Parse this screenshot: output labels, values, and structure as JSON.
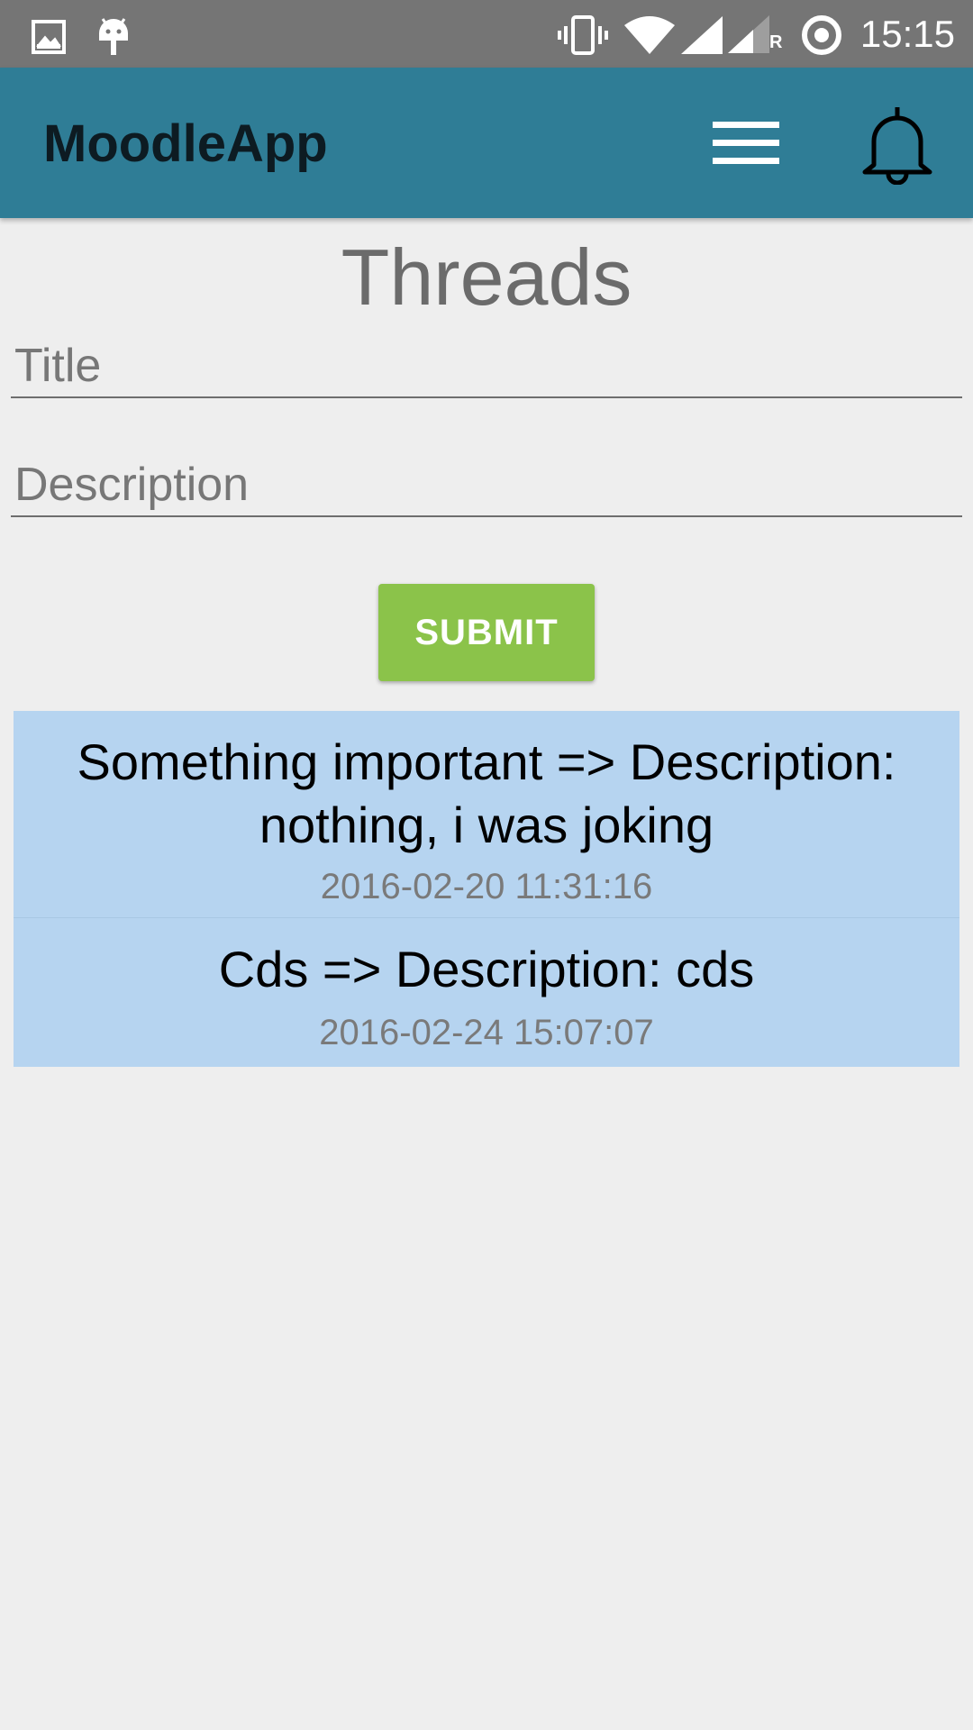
{
  "status_bar": {
    "time": "15:15",
    "left_icons": [
      "image-icon",
      "android-icon"
    ],
    "right_icons": [
      "vibrate-icon",
      "wifi-icon",
      "signal-icon",
      "signal-roaming-icon",
      "sync-icon"
    ],
    "roaming_label": "R"
  },
  "app_bar": {
    "title": "MoodleApp",
    "menu_icon": "hamburger-menu-icon",
    "notification_icon": "bell-icon",
    "background": "#2f7d96"
  },
  "page": {
    "heading": "Threads"
  },
  "form": {
    "title_placeholder": "Title",
    "title_value": "",
    "description_placeholder": "Description",
    "description_value": "",
    "submit_label": "SUBMIT",
    "submit_color": "#8bc34a"
  },
  "threads": [
    {
      "text": "Something important => Description: nothing, i was joking",
      "date": "2016-02-20 11:31:16"
    },
    {
      "text": "Cds => Description: cds",
      "date": "2016-02-24 15:07:07"
    }
  ],
  "colors": {
    "thread_background": "#b6d4f0",
    "status_bar": "#757575",
    "page_background": "#eeeeee"
  }
}
